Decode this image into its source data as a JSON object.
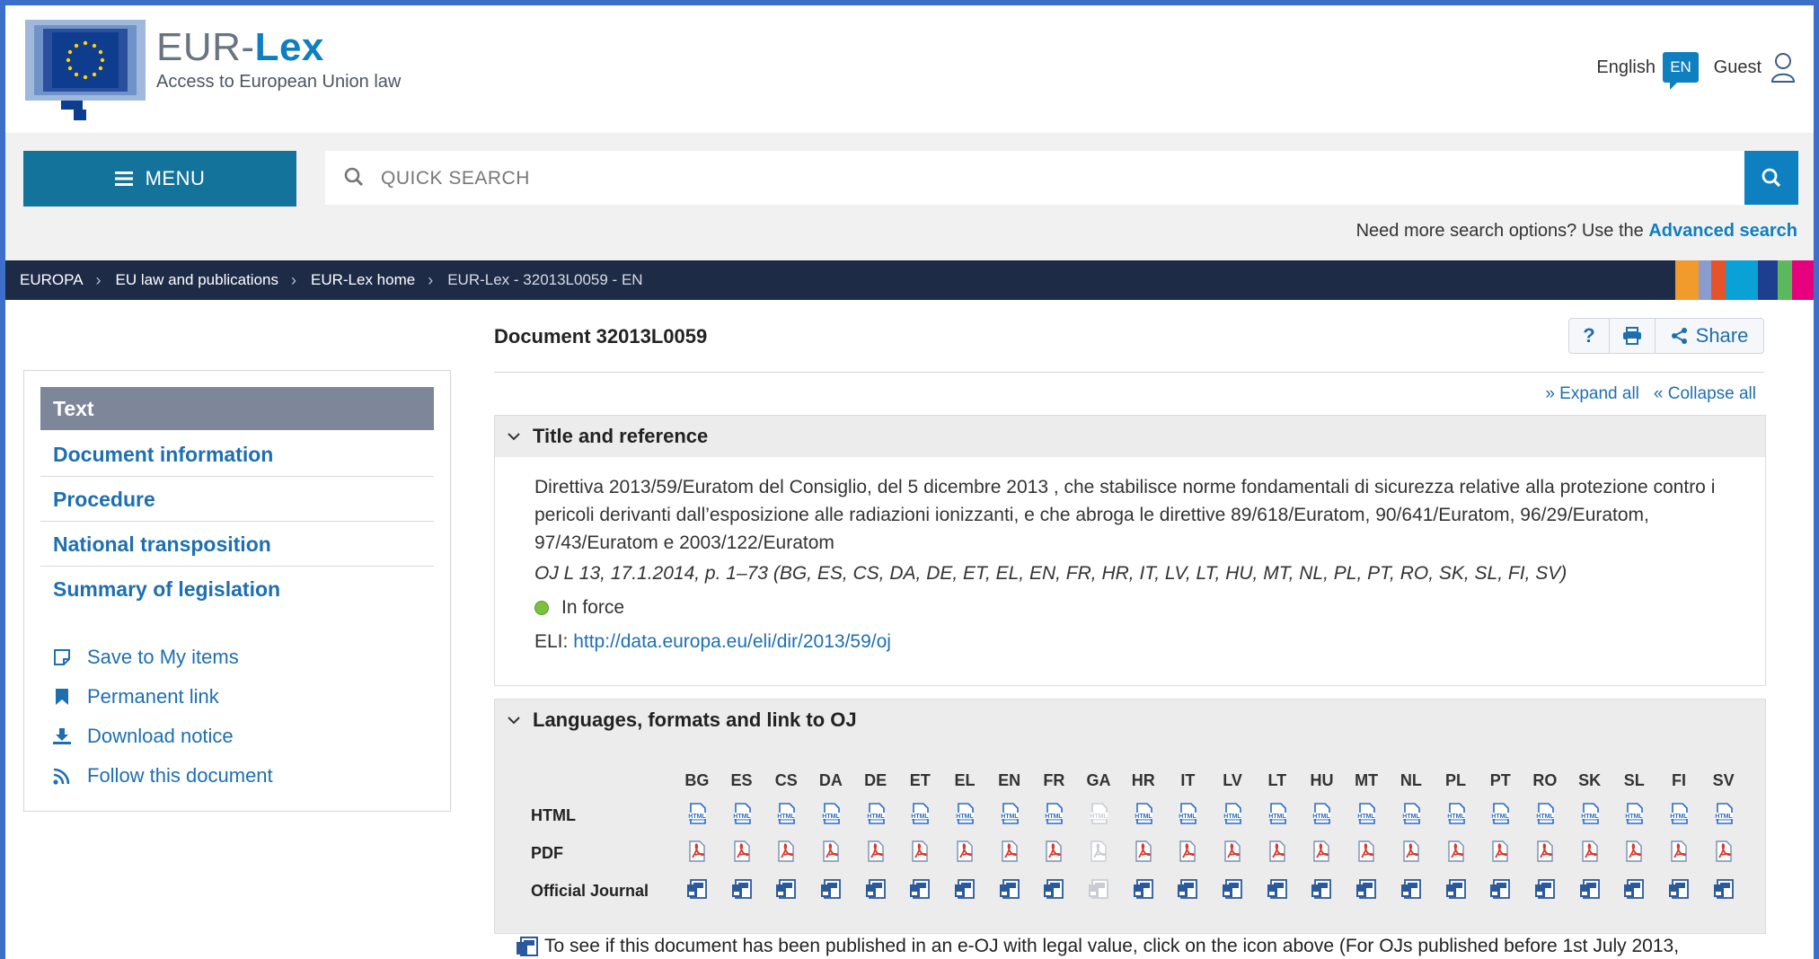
{
  "header": {
    "brand_plain": "EUR-",
    "brand_bold": "Lex",
    "tagline": "Access to European Union law",
    "language": "English",
    "language_code": "EN",
    "user": "Guest"
  },
  "search": {
    "menu_label": "MENU",
    "placeholder": "QUICK SEARCH",
    "advanced_prefix": "Need more search options? Use the",
    "advanced_link": "Advanced search"
  },
  "breadcrumb": [
    "EUROPA",
    "EU law and publications",
    "EUR-Lex home",
    "EUR-Lex - 32013L0059 - EN"
  ],
  "stripe_colors": [
    "#f29b2d",
    "#8a9ccf",
    "#e4532a",
    "#0aa1d6",
    "#0aa1d6",
    "#1e3f8f",
    "#5cb85c",
    "#e6007e"
  ],
  "sidebar": {
    "active_tab": "Text",
    "nav": [
      "Document information",
      "Procedure",
      "National transposition",
      "Summary of legislation"
    ],
    "actions": [
      {
        "label": "Save to My items",
        "icon": "note-icon"
      },
      {
        "label": "Permanent link",
        "icon": "bookmark-icon"
      },
      {
        "label": "Download notice",
        "icon": "download-icon"
      },
      {
        "label": "Follow this document",
        "icon": "rss-icon"
      }
    ]
  },
  "document": {
    "title": "Document 32013L0059",
    "help": "?",
    "share": "Share",
    "expand_all": "Expand all",
    "collapse_all": "Collapse all"
  },
  "title_reference": {
    "heading": "Title and reference",
    "text": "Direttiva 2013/59/Euratom del Consiglio, del 5 dicembre 2013 , che stabilisce norme fondamentali di sicurezza relative alla protezione contro i pericoli derivanti dall’esposizione alle radiazioni ionizzanti, e che abroga le direttive 89/618/Euratom, 90/641/Euratom, 96/29/Euratom, 97/43/Euratom e 2003/122/Euratom",
    "oj": "OJ L 13, 17.1.2014, p. 1–73 (BG, ES, CS, DA, DE, ET, EL, EN, FR, HR, IT, LV, LT, HU, MT, NL, PL, PT, RO, SK, SL, FI, SV)",
    "status": "In force",
    "eli_label": "ELI:",
    "eli_url": "http://data.europa.eu/eli/dir/2013/59/oj"
  },
  "languages": {
    "heading": "Languages, formats and link to OJ",
    "codes": [
      "BG",
      "ES",
      "CS",
      "DA",
      "DE",
      "ET",
      "EL",
      "EN",
      "FR",
      "GA",
      "HR",
      "IT",
      "LV",
      "LT",
      "HU",
      "MT",
      "NL",
      "PL",
      "PT",
      "RO",
      "SK",
      "SL",
      "FI",
      "SV"
    ],
    "unavailable": [
      "GA"
    ],
    "rows": [
      "HTML",
      "PDF",
      "Official Journal"
    ],
    "note": "To see if this document has been published in an e-OJ with legal value, click on the icon above (For OJs published before 1st July 2013,"
  }
}
